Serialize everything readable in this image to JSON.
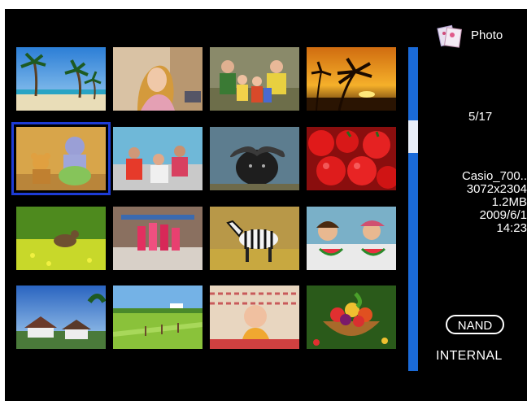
{
  "panel": {
    "mode_label": "Photo",
    "counter": "5/17",
    "file_name": "Casio_700..",
    "resolution": "3072x2304",
    "file_size": "1.2MB",
    "date": "2009/6/1",
    "time": "14:23",
    "storage_badge": "NAND",
    "storage_label": "INTERNAL"
  },
  "grid": {
    "selected_index": 5,
    "thumbnails": [
      "beach-palms",
      "woman-portrait",
      "family-group",
      "sunset-palm",
      "plush-toys",
      "friends-on-car",
      "water-buffalo",
      "red-tomatoes",
      "meadow-animal",
      "market-stall",
      "zebra",
      "kids-watermelon",
      "resort-houses",
      "green-field",
      "baby-portrait",
      "fruit-basket"
    ]
  },
  "scrollbar": {
    "position_fraction": 0.29
  },
  "colors": {
    "accent": "#1a6ad8",
    "selection": "#1e3cd6",
    "background": "#000000"
  }
}
